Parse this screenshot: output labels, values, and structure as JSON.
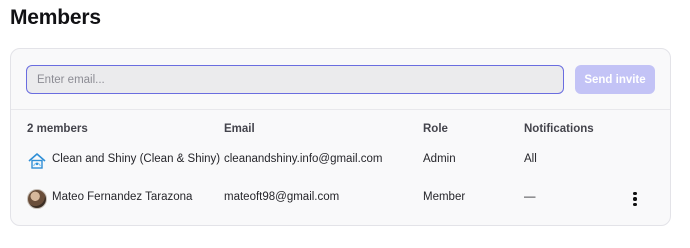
{
  "page": {
    "title": "Members"
  },
  "invite": {
    "placeholder": "Enter email...",
    "value": "",
    "send_label": "Send invite"
  },
  "table": {
    "headers": {
      "count": "2 members",
      "email": "Email",
      "role": "Role",
      "notifications": "Notifications"
    },
    "rows": [
      {
        "name": "Clean and Shiny (Clean & Shiny)",
        "email": "cleanandshiny.info@gmail.com",
        "role": "Admin",
        "notifications": "All",
        "avatar": "house-logo-icon"
      },
      {
        "name": "Mateo Fernandez Tarazona",
        "email": "mateoft98@gmail.com",
        "role": "Member",
        "notifications": "—",
        "avatar": "person-photo-avatar"
      }
    ]
  },
  "colors": {
    "accent": "#6a6de0",
    "button_disabled": "#c3c3f6",
    "house_logo": "#2f8fd6"
  }
}
